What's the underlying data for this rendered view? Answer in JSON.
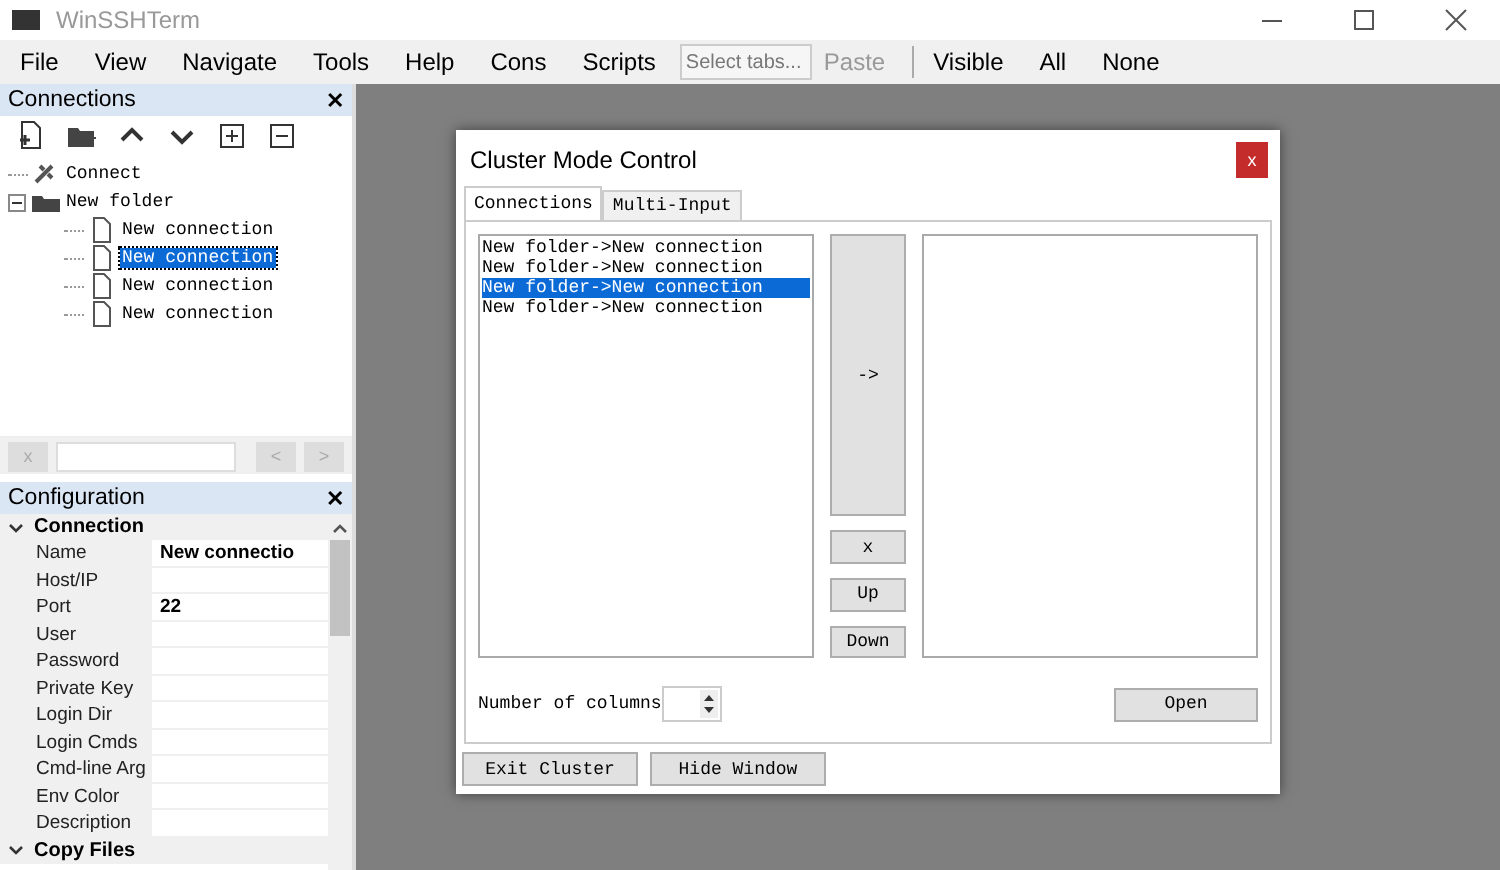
{
  "window": {
    "title": "WinSSHTerm"
  },
  "menu": [
    {
      "label": "File",
      "kind": "item",
      "disabled": false
    },
    {
      "label": "View",
      "kind": "item",
      "disabled": false
    },
    {
      "label": "Navigate",
      "kind": "item",
      "disabled": false
    },
    {
      "label": "Tools",
      "kind": "item",
      "disabled": false
    },
    {
      "label": "Help",
      "kind": "item",
      "disabled": false
    },
    {
      "label": "Cons",
      "kind": "item",
      "disabled": false
    },
    {
      "label": "Scripts",
      "kind": "item",
      "disabled": false
    },
    {
      "placeholder": "Select tabs...",
      "kind": "field"
    },
    {
      "label": "Paste",
      "kind": "item",
      "disabled": true
    },
    {
      "kind": "separator"
    },
    {
      "label": "Visible",
      "kind": "item",
      "disabled": false
    },
    {
      "label": "All",
      "kind": "item",
      "disabled": false
    },
    {
      "label": "None",
      "kind": "item",
      "disabled": false
    }
  ],
  "connections_panel": {
    "title": "Connections",
    "close": "✕",
    "tree": [
      {
        "label": "Connect",
        "kind": "connect",
        "selected": false
      },
      {
        "label": "New folder",
        "kind": "folder",
        "expanded": true,
        "selected": false,
        "children": [
          {
            "label": "New connection",
            "kind": "connection",
            "selected": false
          },
          {
            "label": "New connection",
            "kind": "connection",
            "selected": true
          },
          {
            "label": "New connection",
            "kind": "connection",
            "selected": false
          },
          {
            "label": "New connection",
            "kind": "connection",
            "selected": false
          }
        ]
      }
    ],
    "search": {
      "clear": "x",
      "prev": "<",
      "next": ">"
    }
  },
  "configuration_panel": {
    "title": "Configuration",
    "close": "✕",
    "categories": [
      {
        "label": "Connection",
        "expanded": true,
        "properties": [
          {
            "name": "Name",
            "value": "New connectio"
          },
          {
            "name": "Host/IP"
          },
          {
            "name": "Port",
            "value": "22"
          },
          {
            "name": "User"
          },
          {
            "name": "Password"
          },
          {
            "name": "Private Key"
          },
          {
            "name": "Login Dir"
          },
          {
            "name": "Login Cmds"
          },
          {
            "name": "Cmd-line Arg"
          },
          {
            "name": "Env Color"
          },
          {
            "name": "Description"
          }
        ]
      },
      {
        "label": "Copy Files",
        "expanded": true
      }
    ]
  },
  "dialog": {
    "title": "Cluster Mode Control",
    "close": "x",
    "tabs": [
      {
        "label": "Connections",
        "selected": true
      },
      {
        "label": "Multi-Input",
        "selected": false
      }
    ],
    "available": [
      {
        "label": "New folder->New connection",
        "selected": false
      },
      {
        "label": "New folder->New connection",
        "selected": false
      },
      {
        "label": "New folder->New connection",
        "selected": true
      },
      {
        "label": "New folder->New connection",
        "selected": false
      }
    ],
    "add_button": "->",
    "remove_button": "x",
    "up_button": "Up",
    "down_button": "Down",
    "columns_label": "Number of columns",
    "open_button": "Open",
    "footer_buttons": [
      "Exit Cluster",
      "Hide Window"
    ]
  }
}
